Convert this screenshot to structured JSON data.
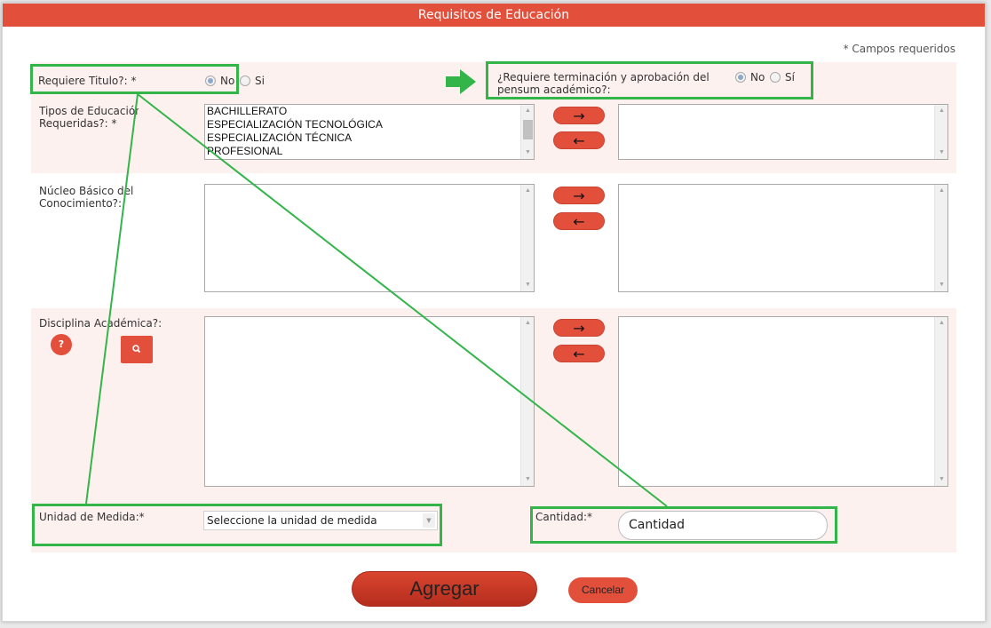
{
  "dialog": {
    "title": "Requisitos de Educación",
    "required_note": "* Campos requeridos"
  },
  "requiere_titulo": {
    "label": "Requiere Titulo?: *",
    "options": [
      "No",
      "Si"
    ],
    "selected": "No"
  },
  "requiere_terminacion": {
    "label_line1": "¿Requiere terminación y aprobación del",
    "label_line2": "pensum académico?:",
    "options": [
      "No",
      "Sí"
    ],
    "selected": "No"
  },
  "tipos_educacion": {
    "label_line1": "Tipos de Educación",
    "label_line2": "Requeridas?: *",
    "available": [
      "BACHILLERATO",
      "ESPECIALIZACIÓN TECNOLÓGICA",
      "ESPECIALIZACIÓN TÉCNICA",
      "PROFESIONAL"
    ],
    "selected_items": []
  },
  "nucleo_basico": {
    "label_line1": "Núcleo Básico del",
    "label_line2": "Conocimiento?:",
    "available": [],
    "selected_items": []
  },
  "disciplina": {
    "label": "Disciplina Académica?:",
    "help_icon_text": "?",
    "search_icon": "magnifier-icon",
    "available": [],
    "selected_items": []
  },
  "transfer_buttons": {
    "add_symbol": "→",
    "remove_symbol": "←"
  },
  "unidad_medida": {
    "label": "Unidad de Medida:*",
    "selected_value": "Seleccione la unidad de medida"
  },
  "cantidad": {
    "label": "Cantidad:*",
    "placeholder": "Cantidad"
  },
  "actions": {
    "agregar_label": "Agregar",
    "cancelar_label": "Cancelar"
  },
  "annotations": {
    "highlight_color": "#33b54a",
    "arrow_color": "#33b54a"
  },
  "colors": {
    "accent": "#e2503c",
    "band": "#fdf1ef"
  }
}
